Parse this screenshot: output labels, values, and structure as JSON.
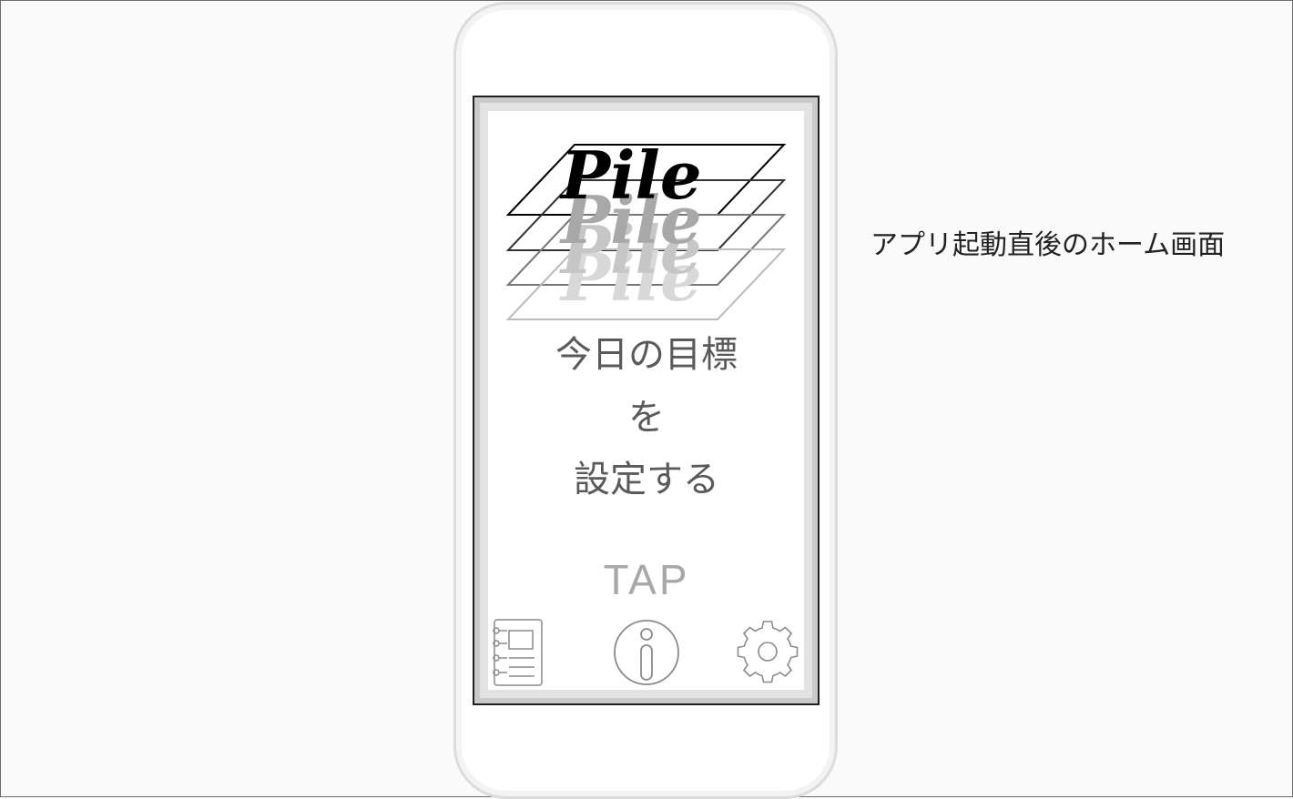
{
  "caption": "アプリ起動直後のホーム画面",
  "app": {
    "logo_text": "Pile",
    "goal_lines": [
      "今日の目標",
      "を",
      "設定する"
    ],
    "tap_label": "TAP"
  },
  "toolbar": {
    "left_icon": "notebook-icon",
    "center_icon": "info-icon",
    "right_icon": "gear-icon"
  },
  "colors": {
    "background": "#fafafa",
    "text_gray": "#5a5a5a",
    "tap_gray": "#a8a8a8",
    "icon_gray": "#8a8a8a"
  }
}
